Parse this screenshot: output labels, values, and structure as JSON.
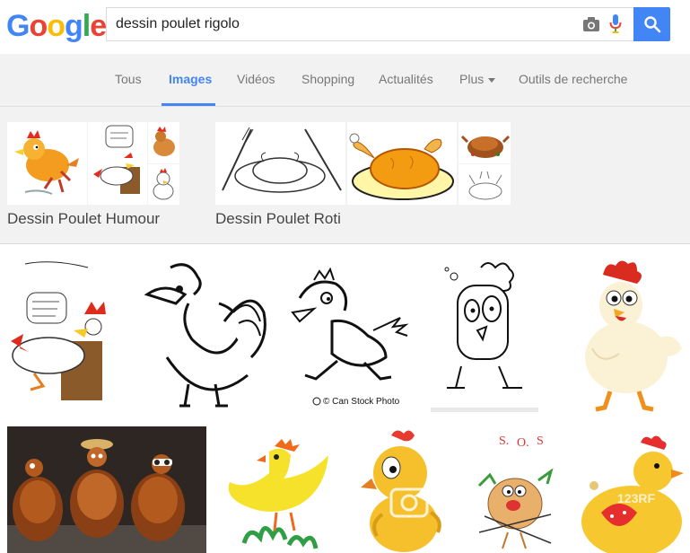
{
  "header": {
    "logo_letters": [
      "G",
      "o",
      "o",
      "g",
      "l",
      "e"
    ],
    "search_value": "dessin poulet rigolo"
  },
  "tabs": [
    {
      "label": "Tous",
      "active": false
    },
    {
      "label": "Images",
      "active": true
    },
    {
      "label": "Vidéos",
      "active": false
    },
    {
      "label": "Shopping",
      "active": false
    },
    {
      "label": "Actualités",
      "active": false
    },
    {
      "label": "Plus",
      "active": false
    },
    {
      "label": "Outils de recherche",
      "active": false
    }
  ],
  "related": [
    {
      "label": "Dessin Poulet Humour"
    },
    {
      "label": "Dessin Poulet Roti"
    }
  ],
  "row1_captions": {
    "img2": "© Can Stock Photo"
  },
  "row2_captions": {
    "img3": "123RF"
  },
  "colors": {
    "accent": "#4285F4",
    "tab_bg": "#f2f2f2"
  }
}
